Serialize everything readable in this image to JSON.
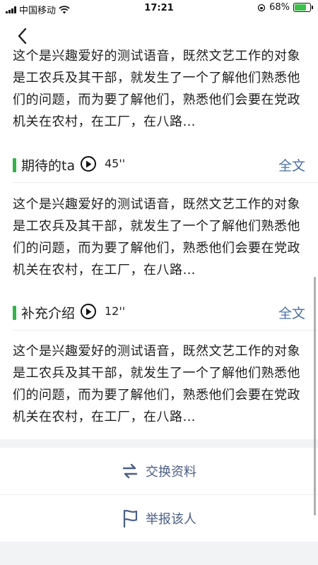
{
  "status_bar": {
    "carrier": "中国移动",
    "time": "17:21",
    "battery_percent": "68%"
  },
  "nav": {
    "back_icon": "chevron-left-icon"
  },
  "paragraphs": [
    "这个是兴趣爱好的测试语音，既然文艺工作的对象是工农兵及其干部，就发生了一个了解他们熟悉他们的问题，而为要了解他们，熟悉他们会要在党政机关在农村，在工厂，在八路…",
    "这个是兴趣爱好的测试语音，既然文艺工作的对象是工农兵及其干部，就发生了一个了解他们熟悉他们的问题，而为要了解他们，熟悉他们会要在党政机关在农村，在工厂，在八路…",
    "这个是兴趣爱好的测试语音，既然文艺工作的对象是工农兵及其干部，就发生了一个了解他们熟悉他们的问题，而为要了解他们，熟悉他们会要在党政机关在农村，在工厂，在八路…"
  ],
  "sections": [
    {
      "title": "期待的ta",
      "duration": "45''",
      "full_text_label": "全文"
    },
    {
      "title": "补充介绍",
      "duration": "12''",
      "full_text_label": "全文"
    }
  ],
  "actions": {
    "exchange_label": "交换资料",
    "exchange_icon": "swap-arrows-icon",
    "report_label": "举报该人",
    "report_icon": "flag-icon"
  },
  "colors": {
    "accent_green": "#35b34a",
    "link_blue": "#4a6fa5",
    "action_text": "#4b5e86"
  }
}
